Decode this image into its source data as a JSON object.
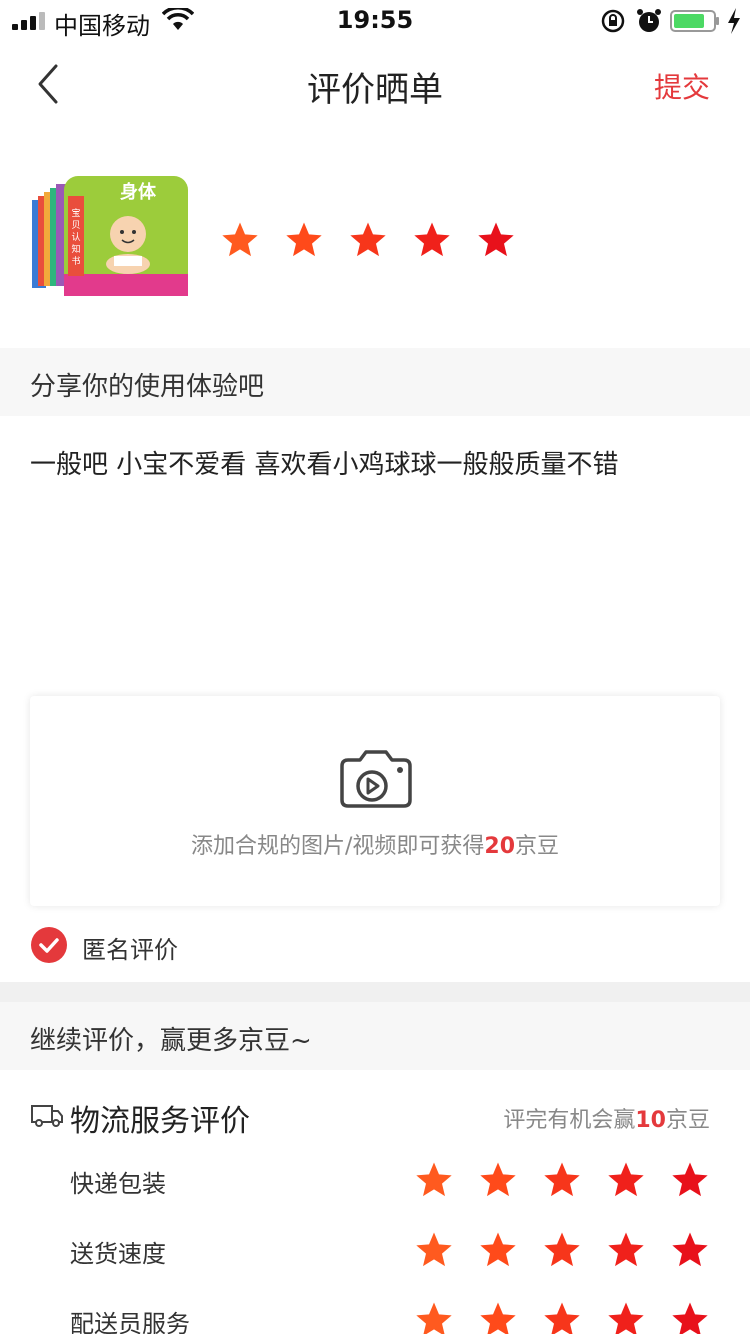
{
  "status_bar": {
    "carrier": "中国移动",
    "time": "19:55"
  },
  "nav": {
    "title": "评价晒单",
    "submit_label": "提交"
  },
  "product": {
    "rating": 5,
    "book_cover": {
      "title": "身体 body",
      "series": "宝贝认知纸板书"
    }
  },
  "share_prompt": "分享你的使用体验吧",
  "review_text": "一般吧 小宝不爱看 喜欢看小鸡球球一般般质量不错",
  "upload": {
    "tip_prefix": "添加合规的图片/视频即可获得",
    "tip_amount": "20",
    "tip_suffix": "京豆"
  },
  "anonymous": {
    "label": "匿名评价",
    "checked": true
  },
  "continue_prompt": "继续评价，赢更多京豆~",
  "logistics": {
    "title": "物流服务评价",
    "tip_prefix": "评完有机会赢",
    "tip_amount": "10",
    "tip_suffix": "京豆",
    "rows": [
      {
        "label": "快递包装",
        "rating": 5
      },
      {
        "label": "送货速度",
        "rating": 5
      },
      {
        "label": "配送员服务",
        "rating": 5
      }
    ]
  },
  "colors": {
    "accent": "#e4393c",
    "star_gradient": [
      "#ff5a1f",
      "#ff4a1a",
      "#f7361b",
      "#f0211b",
      "#e8111b"
    ]
  }
}
